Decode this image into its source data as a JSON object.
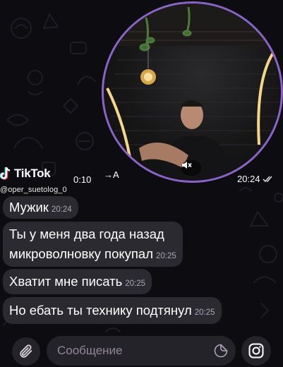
{
  "video_message": {
    "duration": "0:10",
    "translate_label": "→A",
    "time": "20:24",
    "status_icon": "double-check-icon",
    "mute_icon": "muted-speaker-icon"
  },
  "watermark": {
    "brand": "TikTok",
    "handle": "@oper_suetolog_0"
  },
  "messages": [
    {
      "text": "Мужик",
      "time": "20:24"
    },
    {
      "line1": "Ты у меня два года назад",
      "line2": "микроволновку покупал",
      "time": "20:25"
    },
    {
      "text": "Хватит мне писать",
      "time": "20:25"
    },
    {
      "text": "Но ебать ты технику подтянул",
      "time": "20:25"
    }
  ],
  "input": {
    "placeholder": "Сообщение",
    "attach_icon": "paperclip-icon",
    "sticker_icon": "sticker-icon",
    "camera_icon": "instagram-camera-icon"
  },
  "colors": {
    "background": "#0d0c10",
    "bubble": "#2c2a31",
    "accent_ring": "#8a63c8",
    "timestamp": "#a9a6b0"
  }
}
